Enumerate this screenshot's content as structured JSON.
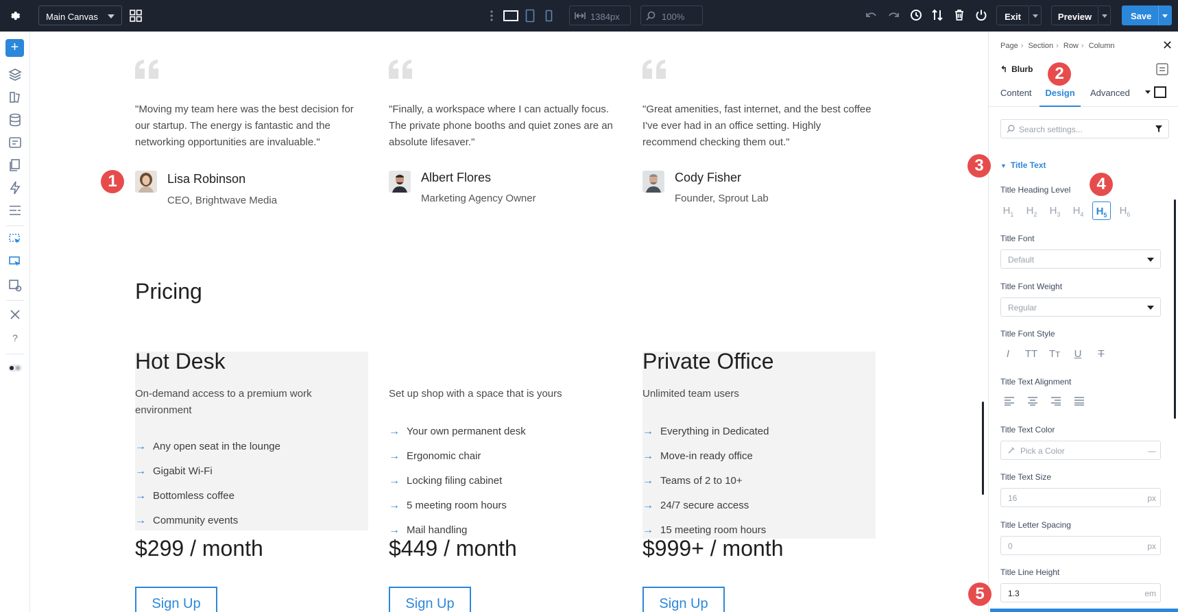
{
  "topbar": {
    "canvas_name": "Main Canvas",
    "width_value": "1384px",
    "zoom_value": "100%",
    "exit_label": "Exit",
    "preview_label": "Preview",
    "save_label": "Save"
  },
  "testimonials": [
    {
      "quote": "\"Moving my team here was the best decision for our startup. The energy is fantastic and the networking opportunities are invaluable.\"",
      "name": "Lisa Robinson",
      "role": "CEO, Brightwave Media"
    },
    {
      "quote": "\"Finally, a workspace where I can actually focus. The private phone booths and quiet zones are an absolute lifesaver.\"",
      "name": "Albert Flores",
      "role": "Marketing Agency Owner"
    },
    {
      "quote": "\"Great amenities, fast internet, and the best coffee I've ever had in an office setting. Highly recommend checking them out.\"",
      "name": "Cody Fisher",
      "role": "Founder, Sprout Lab"
    }
  ],
  "pricing": {
    "heading": "Pricing",
    "plans": [
      {
        "title": "Hot Desk",
        "desc": "On-demand access to a premium work environment",
        "features": [
          "Any open seat in the lounge",
          "Gigabit Wi-Fi",
          "Bottomless coffee",
          "Community events"
        ],
        "price": "$299 / month",
        "cta": "Sign Up"
      },
      {
        "title": "",
        "desc": "Set up shop with a space that is yours",
        "features": [
          "Your own permanent desk",
          "Ergonomic chair",
          "Locking filing cabinet",
          "5 meeting room hours",
          "Mail handling"
        ],
        "price": "$449 / month",
        "cta": "Sign Up"
      },
      {
        "title": "Private Office",
        "desc": "Unlimited team users",
        "features": [
          "Everything in Dedicated",
          "Move-in ready office",
          "Teams of 2 to 10+",
          "24/7 secure access",
          "15 meeting room hours"
        ],
        "price": "$999+ / month",
        "cta": "Sign Up"
      }
    ]
  },
  "badges": [
    "1",
    "2",
    "3",
    "4",
    "5"
  ],
  "panel": {
    "breadcrumb": [
      "Page",
      "Section",
      "Row",
      "Column"
    ],
    "module": "Blurb",
    "tabs": [
      "Content",
      "Design",
      "Advanced"
    ],
    "search_placeholder": "Search settings...",
    "group": "Title Text",
    "heading_level_label": "Title Heading Level",
    "heading_levels": [
      "H",
      "H",
      "H",
      "H",
      "H",
      "H"
    ],
    "heading_nums": [
      "1",
      "2",
      "3",
      "4",
      "5",
      "6"
    ],
    "font_label": "Title Font",
    "font_value": "Default",
    "weight_label": "Title Font Weight",
    "weight_value": "Regular",
    "style_label": "Title Font Style",
    "style_icons": [
      "I",
      "TT",
      "Tт",
      "U",
      "T"
    ],
    "align_label": "Title Text Alignment",
    "color_label": "Title Text Color",
    "color_placeholder": "Pick a Color",
    "color_dash": "—",
    "size_label": "Title Text Size",
    "size_value": "16",
    "spacing_label": "Title Letter Spacing",
    "spacing_value": "0",
    "line_label": "Title Line Height",
    "line_value": "1.3",
    "unit_px": "px",
    "unit_em": "em"
  }
}
